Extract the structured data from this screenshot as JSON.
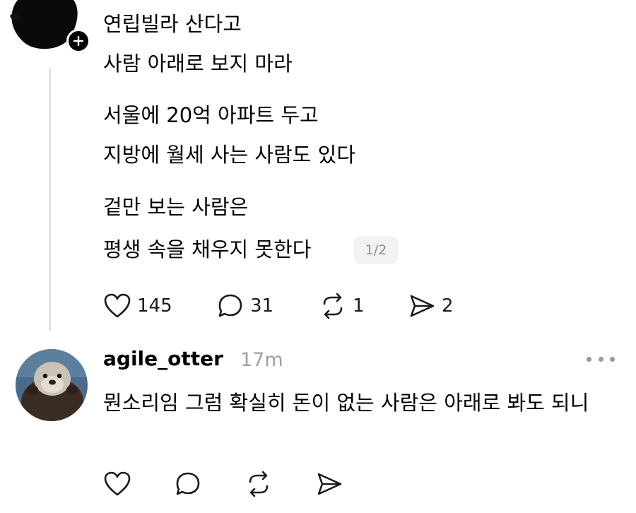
{
  "post": {
    "lines": [
      "연립빌라 산다고",
      "사람 아래로 보지 마라",
      "서울에 20억 아파트 두고",
      "지방에 월세 사는 사람도 있다",
      "겉만 보는 사람은",
      "평생 속을 채우지 못한다"
    ],
    "page_indicator": "1/2",
    "actions": {
      "likes": "145",
      "comments": "31",
      "reposts": "1",
      "shares": "2"
    }
  },
  "reply": {
    "username": "agile_otter",
    "time": "17m",
    "text": "뭔소리임 그럼 확실히 돈이 없는 사람은 아래로 봐도 되니"
  },
  "icons": {
    "like": "heart-icon",
    "comment": "comment-bubble-icon",
    "repost": "repost-icon",
    "share": "send-icon",
    "more": "more-dots-icon",
    "follow": "plus-icon"
  },
  "colors": {
    "text": "#000000",
    "muted": "#a0a0a0",
    "thread_line": "#e2e2e2",
    "pill_bg": "#f2f2f2"
  }
}
